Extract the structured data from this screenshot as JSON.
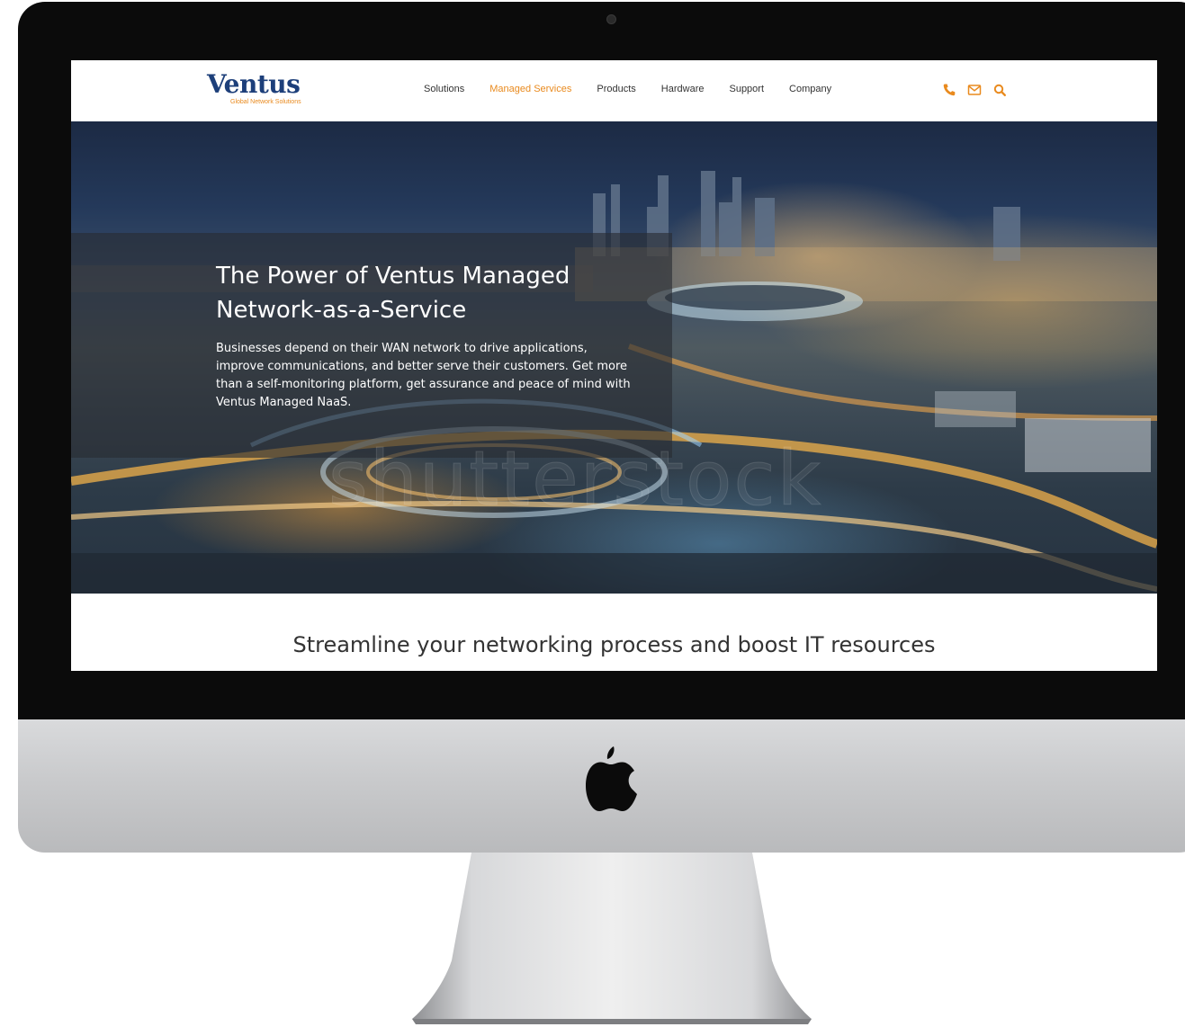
{
  "site": {
    "logo": {
      "name": "Ventus",
      "tagline": "Global Network Solutions"
    },
    "nav": {
      "items": [
        {
          "label": "Solutions",
          "active": false
        },
        {
          "label": "Managed Services",
          "active": true
        },
        {
          "label": "Products",
          "active": false
        },
        {
          "label": "Hardware",
          "active": false
        },
        {
          "label": "Support",
          "active": false
        },
        {
          "label": "Company",
          "active": false
        }
      ],
      "icons": [
        "phone-icon",
        "mail-icon",
        "search-icon"
      ]
    },
    "hero": {
      "title": "The Power of Ventus Managed Network-as-a-Service",
      "body": "Businesses depend on their WAN network to drive applications, improve communications, and better serve their customers. Get more than a self-monitoring platform, get assurance and peace of mind with Ventus Managed NaaS.",
      "watermark": "shutterstock"
    },
    "section": {
      "title": "Streamline your networking process and boost IT resources"
    }
  },
  "colors": {
    "accent": "#e98a1e",
    "brand": "#1d3f7a",
    "nav_text": "#333333"
  }
}
